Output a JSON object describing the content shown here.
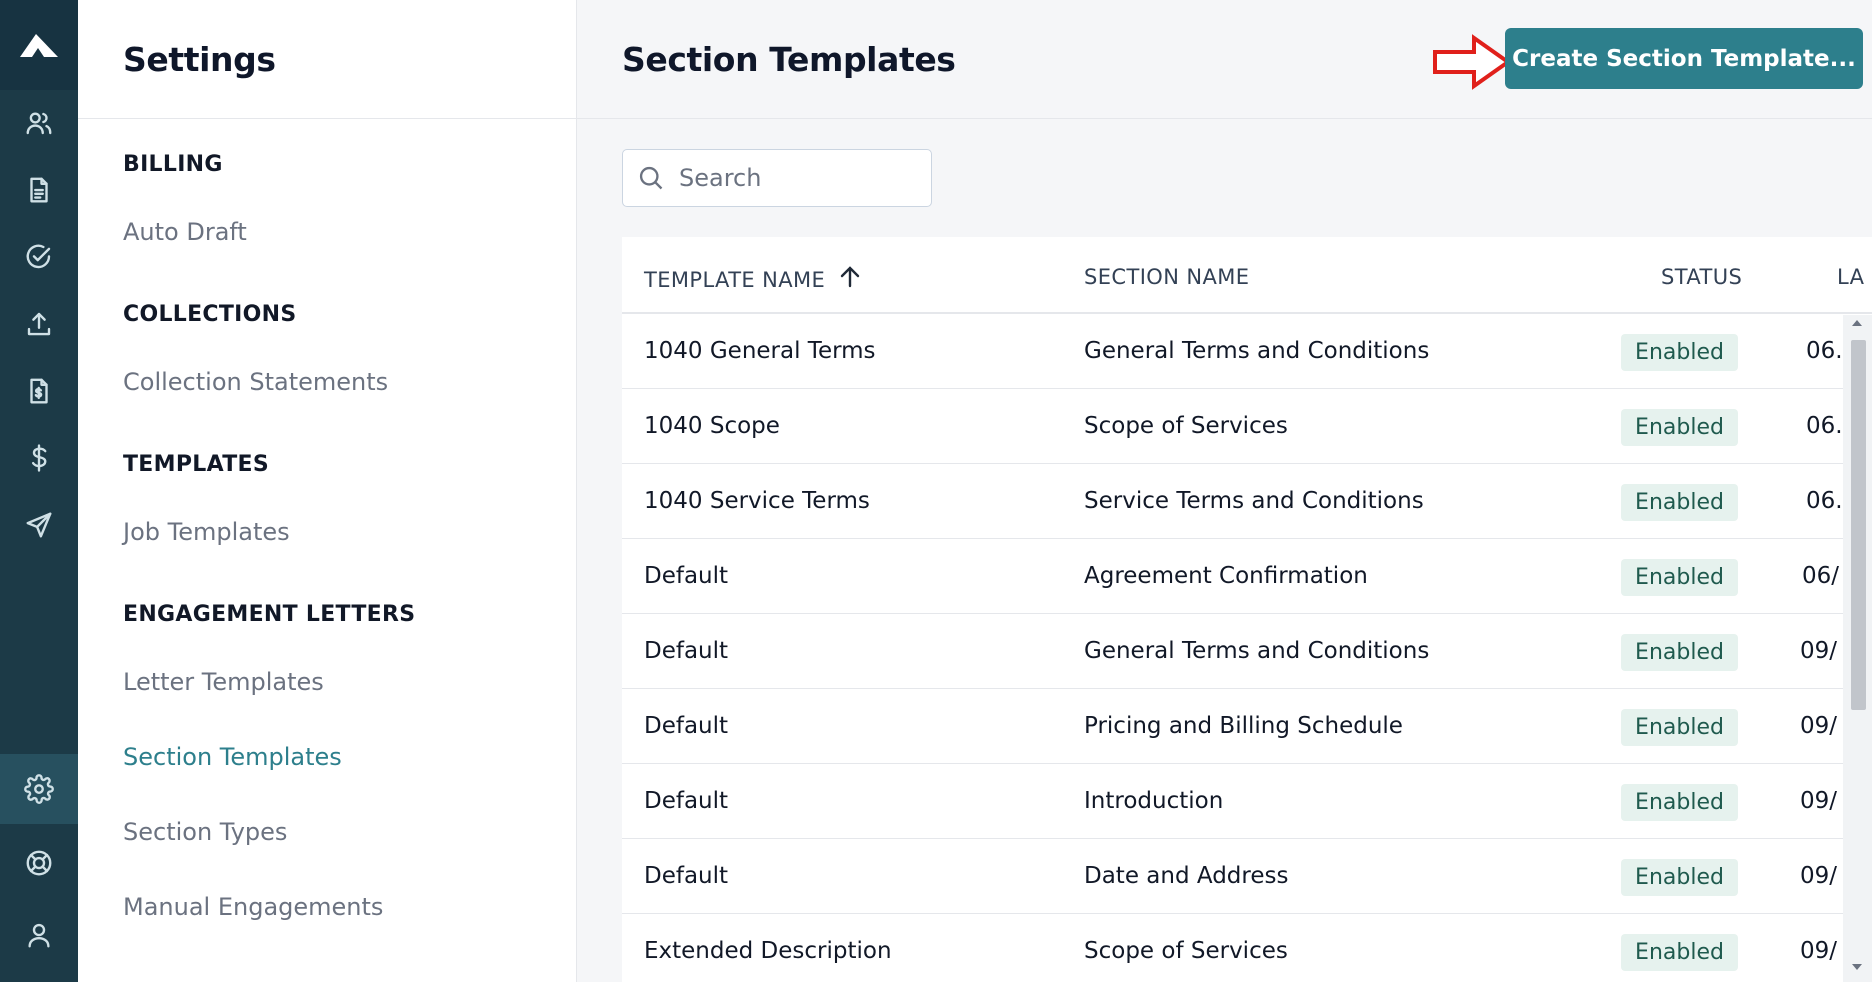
{
  "rail": {
    "icons": [
      "users-icon",
      "document-icon",
      "check-circle-icon",
      "upload-icon",
      "invoice-icon",
      "dollar-icon",
      "send-icon",
      "gear-icon",
      "lifebuoy-icon",
      "user-icon"
    ],
    "active": "gear-icon"
  },
  "settings": {
    "title": "Settings",
    "groups": [
      {
        "heading": "BILLING",
        "items": [
          "Auto Draft"
        ]
      },
      {
        "heading": "COLLECTIONS",
        "items": [
          "Collection Statements"
        ]
      },
      {
        "heading": "TEMPLATES",
        "items": [
          "Job Templates"
        ]
      },
      {
        "heading": "ENGAGEMENT LETTERS",
        "items": [
          "Letter Templates",
          "Section Templates",
          "Section Types",
          "Manual Engagements"
        ]
      }
    ],
    "active_item": "Section Templates"
  },
  "main": {
    "title": "Section Templates",
    "create_label": "Create Section Template...",
    "search_placeholder": "Search"
  },
  "table": {
    "columns": [
      "TEMPLATE NAME",
      "SECTION NAME",
      "STATUS",
      "LA"
    ],
    "sort_column": "TEMPLATE NAME",
    "rows": [
      {
        "template": "1040 General Terms",
        "section": "General Terms and Conditions",
        "status": "Enabled",
        "date": "06."
      },
      {
        "template": "1040 Scope",
        "section": "Scope of Services",
        "status": "Enabled",
        "date": "06."
      },
      {
        "template": "1040 Service Terms",
        "section": "Service Terms and Conditions",
        "status": "Enabled",
        "date": "06."
      },
      {
        "template": "Default",
        "section": "Agreement Confirmation",
        "status": "Enabled",
        "date": "06/"
      },
      {
        "template": "Default",
        "section": "General Terms and Conditions",
        "status": "Enabled",
        "date": "09/"
      },
      {
        "template": "Default",
        "section": "Pricing and Billing Schedule",
        "status": "Enabled",
        "date": "09/"
      },
      {
        "template": "Default",
        "section": "Introduction",
        "status": "Enabled",
        "date": "09/"
      },
      {
        "template": "Default",
        "section": "Date and Address",
        "status": "Enabled",
        "date": "09/"
      },
      {
        "template": "Extended Description",
        "section": "Scope of Services",
        "status": "Enabled",
        "date": "09/"
      }
    ]
  },
  "colors": {
    "accent": "#2d7f8c",
    "rail": "#1c3a47",
    "badge_bg": "#e6f2ee",
    "annotation_arrow": "#e0201b"
  }
}
